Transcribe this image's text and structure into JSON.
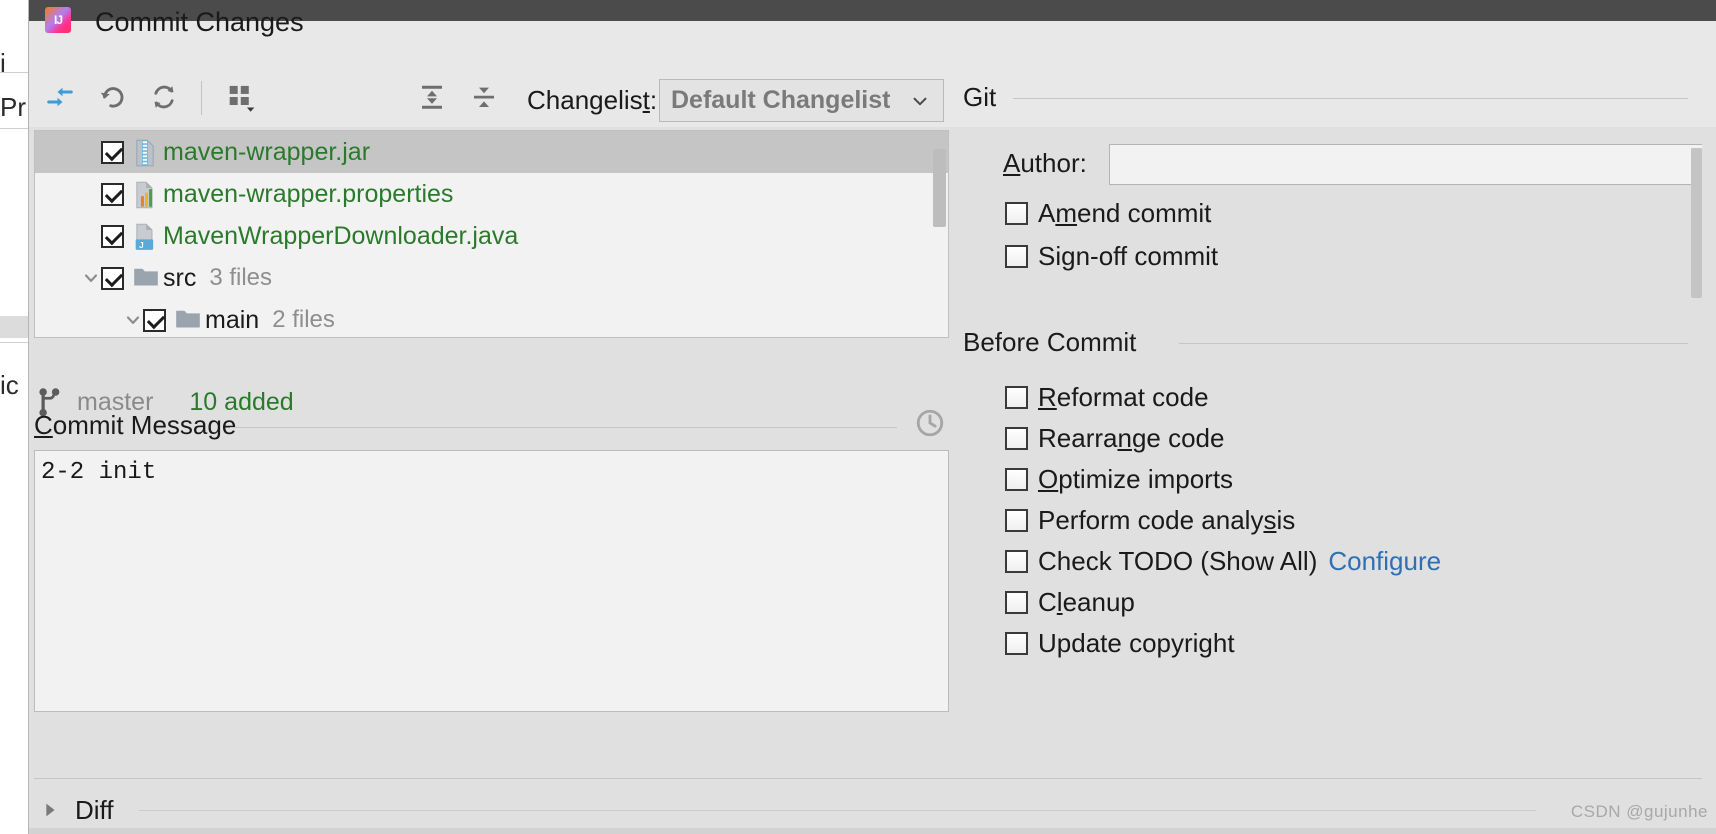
{
  "window": {
    "title": "Commit Changes",
    "app_icon": "intellij-idea-icon"
  },
  "toolbar": {
    "buttons": [
      {
        "name": "group-by-icon",
        "tooltip": "Move to Another Changelist"
      },
      {
        "name": "revert-icon",
        "tooltip": "Revert"
      },
      {
        "name": "refresh-icon",
        "tooltip": "Refresh"
      },
      {
        "name": "group-by-grid-icon",
        "tooltip": "Group By"
      },
      {
        "name": "expand-all-icon",
        "tooltip": "Expand All"
      },
      {
        "name": "collapse-all-icon",
        "tooltip": "Collapse All"
      }
    ],
    "changelist_label": "Changelist:",
    "changelist_mnemonic": "t",
    "changelist_value": "Default Changelist"
  },
  "file_tree": {
    "rows": [
      {
        "indent": 0,
        "arrow": "",
        "checked": true,
        "icon": "jar-archive-icon",
        "label": "maven-wrapper.jar",
        "count": "",
        "selected": true,
        "type": "file"
      },
      {
        "indent": 0,
        "arrow": "",
        "checked": true,
        "icon": "properties-file-icon",
        "label": "maven-wrapper.properties",
        "count": "",
        "selected": false,
        "type": "file"
      },
      {
        "indent": 0,
        "arrow": "",
        "checked": true,
        "icon": "java-file-icon",
        "label": "MavenWrapperDownloader.java",
        "count": "",
        "selected": false,
        "type": "file"
      },
      {
        "indent": 0,
        "arrow": "down",
        "checked": true,
        "icon": "folder-icon",
        "label": "src",
        "count": "3 files",
        "selected": false,
        "type": "folder"
      },
      {
        "indent": 1,
        "arrow": "down",
        "checked": true,
        "icon": "folder-icon",
        "label": "main",
        "count": "2 files",
        "selected": false,
        "type": "folder"
      }
    ]
  },
  "status_bar": {
    "branch_icon": "git-branch-icon",
    "branch": "master",
    "stats": "10 added"
  },
  "commit_message": {
    "title": "Commit Message",
    "mnemonic": "C",
    "history_icon": "clock-history-icon",
    "value": "2-2 init"
  },
  "git_section": {
    "title": "Git",
    "author_label": "Author:",
    "author_mnemonic": "A",
    "author_value": "",
    "checkboxes": [
      {
        "label_pre": "A",
        "label_mn": "m",
        "label_post": "end commit",
        "label": "Amend commit",
        "checked": false,
        "name": "amend-commit-checkbox"
      },
      {
        "label_pre": "Si",
        "label_mn": "g",
        "label_post": "n-off commit",
        "label": "Sign-off commit",
        "checked": false,
        "name": "sign-off-commit-checkbox"
      }
    ]
  },
  "before_commit_section": {
    "title": "Before Commit",
    "checkboxes": [
      {
        "label_pre": "",
        "label_mn": "R",
        "label_post": "eformat code",
        "label": "Reformat code",
        "checked": false,
        "name": "reformat-code-checkbox",
        "link": ""
      },
      {
        "label_pre": "Rearra",
        "label_mn": "n",
        "label_post": "ge code",
        "label": "Rearrange code",
        "checked": false,
        "name": "rearrange-code-checkbox",
        "link": ""
      },
      {
        "label_pre": "",
        "label_mn": "O",
        "label_post": "ptimize imports",
        "label": "Optimize imports",
        "checked": false,
        "name": "optimize-imports-checkbox",
        "link": ""
      },
      {
        "label_pre": "Perform code analy",
        "label_mn": "s",
        "label_post": "is",
        "label": "Perform code analysis",
        "checked": false,
        "name": "perform-code-analysis-checkbox",
        "link": ""
      },
      {
        "label_pre": "Check TODO (Show All)",
        "label_mn": "",
        "label_post": "",
        "label": "Check TODO (Show All)",
        "checked": false,
        "name": "check-todo-checkbox",
        "link": "Configure"
      },
      {
        "label_pre": "C",
        "label_mn": "l",
        "label_post": "eanup",
        "label": "Cleanup",
        "checked": false,
        "name": "cleanup-checkbox",
        "link": ""
      },
      {
        "label_pre": "Update copyright",
        "label_mn": "",
        "label_post": "",
        "label": "Update copyright",
        "checked": false,
        "name": "update-copyright-checkbox",
        "link": ""
      }
    ]
  },
  "diff_section": {
    "label": "Diff",
    "expanded": false
  },
  "watermark": "CSDN @gujunhe",
  "background_editor": {
    "fragments": [
      "i",
      "Pr",
      "ic"
    ]
  },
  "colors": {
    "accent_blue": "#2f6fb5",
    "added_green": "#2b7a2b",
    "dialog_bg": "#e0e0e0",
    "panel_bg": "#f2f2f2",
    "selection": "#c5c5c5"
  }
}
